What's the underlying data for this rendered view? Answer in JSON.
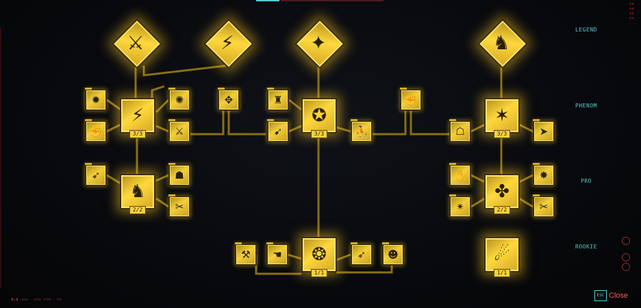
{
  "tiers": [
    {
      "label": "LEGEND"
    },
    {
      "label": "PHENOM"
    },
    {
      "label": "PRO"
    },
    {
      "label": "ROOKIE"
    }
  ],
  "levels": {
    "hub_left_upper": "3/3",
    "hub_left_lower": "2/2",
    "hub_center": "3/3",
    "hub_bottom_center": "1/1",
    "hub_right_upper": "3/3",
    "hub_right_lower": "2/2",
    "hub_right_bottom": "1/1"
  },
  "close": {
    "key": "ESC",
    "label": "Close"
  },
  "colors": {
    "gold": "#f2cf3a",
    "wire": "#8a6f14",
    "tier_label": "#5fc8cf",
    "close": "#ff5a5a",
    "accent_cyan": "#58d8e0"
  },
  "icons": {
    "legend_1": "legend-perk-1-icon",
    "legend_2": "legend-perk-2-icon",
    "legend_3": "legend-perk-3-icon",
    "legend_4": "legend-perk-4-icon"
  }
}
